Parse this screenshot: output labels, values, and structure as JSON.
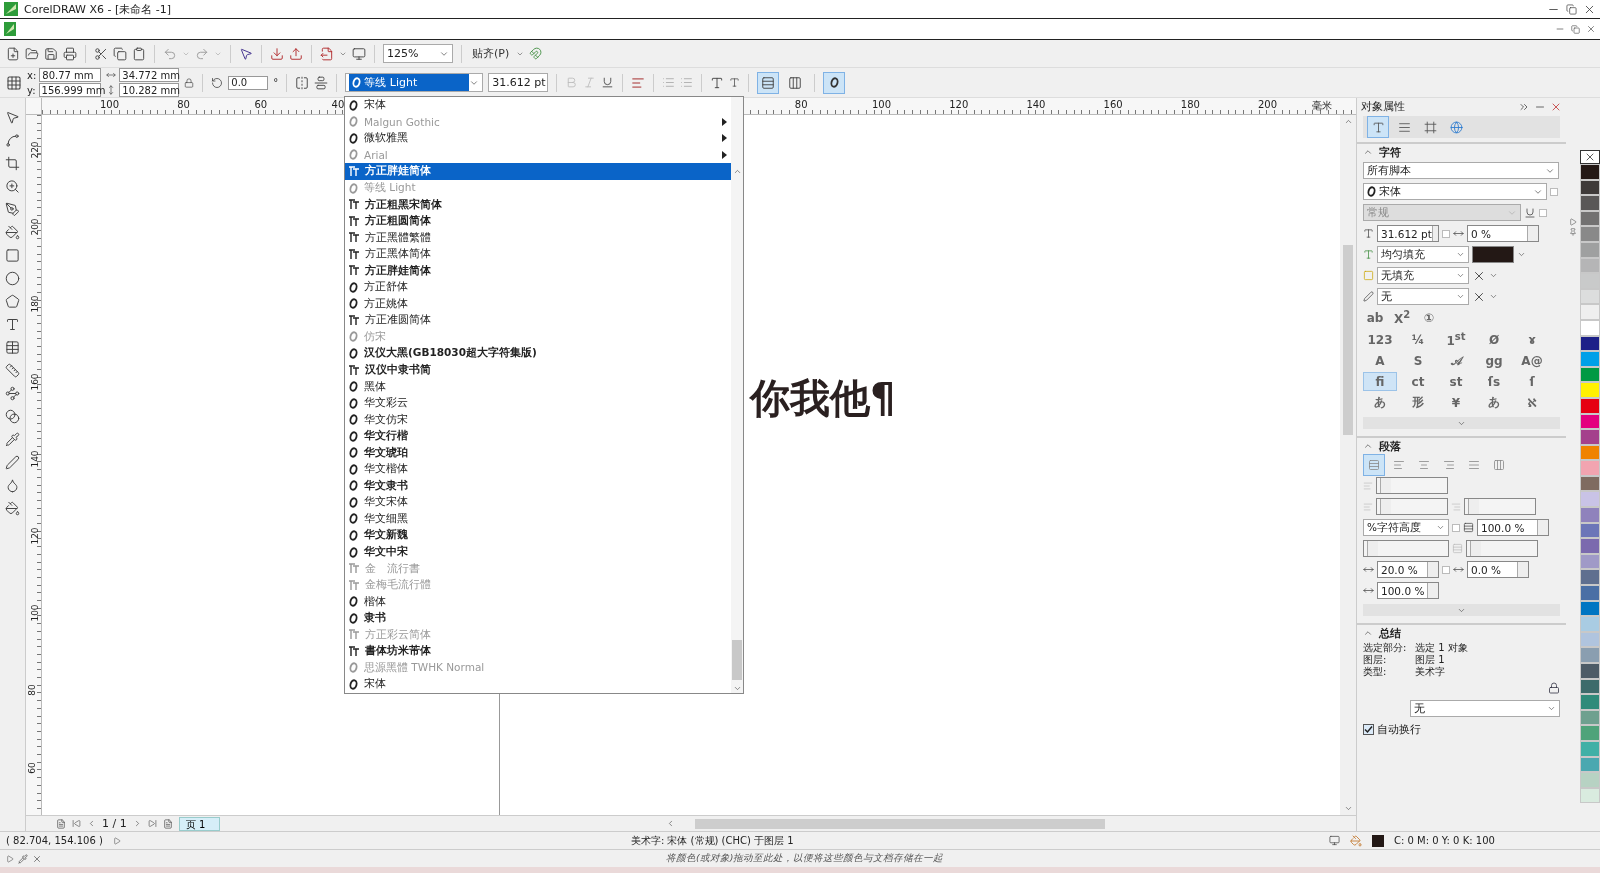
{
  "title_bar": {
    "title": "CorelDRAW X6 - [未命名 -1]"
  },
  "toolbar": {
    "zoom": "125%",
    "snap": "贴齐(P)"
  },
  "property_bar": {
    "x_label": "x:",
    "x": "80.77 mm",
    "y_label": "y:",
    "y": "156.999 mm",
    "width": "34.772 mm",
    "height": "10.282 mm",
    "rotation": "0.0",
    "degree": "°",
    "font": "等线 Light",
    "font_size": "31.612 pt",
    "orientation": [
      {
        "kind": "horizontal",
        "selected": true
      },
      {
        "kind": "vertical",
        "selected": false
      }
    ],
    "opentype_on": true
  },
  "font_list": [
    {
      "name": "宋体",
      "kind": "opentype",
      "greyed": false,
      "bold": false,
      "submenu": false,
      "selected": false
    },
    {
      "name": "Malgun Gothic",
      "kind": "opentype",
      "greyed": true,
      "bold": false,
      "submenu": true,
      "selected": false
    },
    {
      "name": "微软雅黑",
      "kind": "opentype",
      "greyed": false,
      "bold": false,
      "submenu": true,
      "selected": false
    },
    {
      "name": "Arial",
      "kind": "opentype",
      "greyed": true,
      "bold": false,
      "submenu": true,
      "selected": false
    },
    {
      "name": "方正胖娃简体",
      "kind": "truetype",
      "greyed": false,
      "bold": true,
      "submenu": false,
      "selected": true
    },
    {
      "name": "等线 Light",
      "kind": "opentype",
      "greyed": true,
      "bold": false,
      "submenu": false,
      "selected": false
    },
    {
      "name": "方正粗黑宋简体",
      "kind": "truetype",
      "greyed": false,
      "bold": true,
      "submenu": false,
      "selected": false
    },
    {
      "name": "方正粗圆简体",
      "kind": "truetype",
      "greyed": false,
      "bold": true,
      "submenu": false,
      "selected": false
    },
    {
      "name": "方正黑體繁體",
      "kind": "truetype",
      "greyed": false,
      "bold": false,
      "submenu": false,
      "selected": false
    },
    {
      "name": "方正黑体简体",
      "kind": "truetype",
      "greyed": false,
      "bold": false,
      "submenu": false,
      "selected": false
    },
    {
      "name": "方正胖娃简体",
      "kind": "truetype",
      "greyed": false,
      "bold": true,
      "submenu": false,
      "selected": false
    },
    {
      "name": "方正舒体",
      "kind": "opentype",
      "greyed": false,
      "bold": false,
      "submenu": false,
      "selected": false
    },
    {
      "name": "方正姚体",
      "kind": "opentype",
      "greyed": false,
      "bold": false,
      "submenu": false,
      "selected": false
    },
    {
      "name": "方正准圆简体",
      "kind": "truetype",
      "greyed": false,
      "bold": false,
      "submenu": false,
      "selected": false
    },
    {
      "name": "仿宋",
      "kind": "opentype",
      "greyed": true,
      "bold": false,
      "submenu": false,
      "selected": false
    },
    {
      "name": "汉仪大黑(GB18030超大字符集版)",
      "kind": "opentype",
      "greyed": false,
      "bold": true,
      "submenu": false,
      "selected": false
    },
    {
      "name": "汉仪中隶书简",
      "kind": "truetype",
      "greyed": false,
      "bold": true,
      "submenu": false,
      "selected": false
    },
    {
      "name": "黑体",
      "kind": "opentype",
      "greyed": false,
      "bold": false,
      "submenu": false,
      "selected": false
    },
    {
      "name": "华文彩云",
      "kind": "opentype",
      "greyed": false,
      "bold": false,
      "submenu": false,
      "selected": false
    },
    {
      "name": "华文仿宋",
      "kind": "opentype",
      "greyed": false,
      "bold": false,
      "submenu": false,
      "selected": false
    },
    {
      "name": "华文行楷",
      "kind": "opentype",
      "greyed": false,
      "bold": true,
      "submenu": false,
      "selected": false
    },
    {
      "name": "华文琥珀",
      "kind": "opentype",
      "greyed": false,
      "bold": true,
      "submenu": false,
      "selected": false
    },
    {
      "name": "华文楷体",
      "kind": "opentype",
      "greyed": false,
      "bold": false,
      "submenu": false,
      "selected": false
    },
    {
      "name": "华文隶书",
      "kind": "opentype",
      "greyed": false,
      "bold": true,
      "submenu": false,
      "selected": false
    },
    {
      "name": "华文宋体",
      "kind": "opentype",
      "greyed": false,
      "bold": false,
      "submenu": false,
      "selected": false
    },
    {
      "name": "华文细黑",
      "kind": "opentype",
      "greyed": false,
      "bold": false,
      "submenu": false,
      "selected": false
    },
    {
      "name": "华文新魏",
      "kind": "opentype",
      "greyed": false,
      "bold": true,
      "submenu": false,
      "selected": false
    },
    {
      "name": "华文中宋",
      "kind": "opentype",
      "greyed": false,
      "bold": true,
      "submenu": false,
      "selected": false
    },
    {
      "name": "金　流行書",
      "kind": "truetype",
      "greyed": true,
      "bold": false,
      "submenu": false,
      "selected": false
    },
    {
      "name": "金梅毛流行體",
      "kind": "truetype",
      "greyed": true,
      "bold": false,
      "submenu": false,
      "selected": false
    },
    {
      "name": "楷体",
      "kind": "opentype",
      "greyed": false,
      "bold": false,
      "submenu": false,
      "selected": false
    },
    {
      "name": "隶书",
      "kind": "opentype",
      "greyed": false,
      "bold": true,
      "submenu": false,
      "selected": false
    },
    {
      "name": "方正彩云简体",
      "kind": "truetype",
      "greyed": true,
      "bold": false,
      "submenu": false,
      "selected": false
    },
    {
      "name": "書体坊米芾体",
      "kind": "truetype",
      "greyed": false,
      "bold": true,
      "submenu": false,
      "selected": false
    },
    {
      "name": "思源黑體 TWHK Normal",
      "kind": "opentype",
      "greyed": true,
      "bold": false,
      "submenu": false,
      "selected": false
    },
    {
      "name": "宋体",
      "kind": "opentype",
      "greyed": false,
      "bold": false,
      "submenu": false,
      "selected": false
    }
  ],
  "rulers": {
    "horizontal": [
      "100",
      "80",
      "60",
      "40",
      "80",
      "100",
      "120",
      "140",
      "160",
      "180",
      "200"
    ],
    "unit": "毫米",
    "vertical": [
      "220",
      "200",
      "180",
      "160",
      "140",
      "120",
      "100",
      "80",
      "60"
    ]
  },
  "canvas": {
    "text": "你我他¶"
  },
  "page_nav": {
    "count": "1 / 1",
    "tabs": [
      {
        "label": "页 1",
        "selected": true
      }
    ]
  },
  "docker": {
    "title": "对象属性",
    "tabs": [
      {
        "kind": "character",
        "selected": true
      },
      {
        "kind": "paragraph",
        "selected": false
      },
      {
        "kind": "frame",
        "selected": false
      },
      {
        "kind": "web",
        "selected": false
      }
    ],
    "character": {
      "title": "字符",
      "script": "所有脚本",
      "font": "宋体",
      "style": "常规",
      "size": "31.612 pt",
      "kerning": "0 %",
      "fill": "均匀填充",
      "background": "无填充",
      "outline": "无",
      "features": [
        {
          "glyph": "ab",
          "selected": false
        },
        {
          "glyph": "X$^{2}$",
          "selected": false
        },
        {
          "glyph": "①",
          "selected": false
        }
      ],
      "opentype": [
        {
          "glyph": "123",
          "selected": false
        },
        {
          "glyph": "¼",
          "selected": false
        },
        {
          "glyph": "1$^{st}$",
          "selected": false
        },
        {
          "glyph": "Ø",
          "selected": false
        },
        {
          "glyph": "ɤ",
          "selected": false
        },
        {
          "glyph": "A",
          "selected": false
        },
        {
          "glyph": "S",
          "selected": false
        },
        {
          "glyph": "𝒜",
          "selected": false
        },
        {
          "glyph": "gg",
          "selected": false
        },
        {
          "glyph": "A@",
          "selected": false
        },
        {
          "glyph": "fi",
          "selected": true
        },
        {
          "glyph": "ct",
          "selected": false
        },
        {
          "glyph": "st",
          "selected": false
        },
        {
          "glyph": "ſs",
          "selected": false
        },
        {
          "glyph": "ſ",
          "selected": false
        },
        {
          "glyph": "あ",
          "selected": false
        },
        {
          "glyph": "形",
          "selected": false
        },
        {
          "glyph": "¥",
          "selected": false
        },
        {
          "glyph": "あ",
          "selected": false
        },
        {
          "glyph": "ℵ",
          "selected": false
        }
      ]
    },
    "paragraph": {
      "title": "段落",
      "alignments": [
        {
          "kind": "none",
          "selected": true
        },
        {
          "kind": "left",
          "selected": false
        },
        {
          "kind": "center",
          "selected": false
        },
        {
          "kind": "right",
          "selected": false
        },
        {
          "kind": "full",
          "selected": false
        },
        {
          "kind": "force",
          "selected": false
        }
      ],
      "spacing_unit": "%字符高度",
      "line_spacing": "100.0 %",
      "char_spacing": "20.0 %",
      "word_spacing": "0.0 %",
      "lang_spacing": "100.0 %"
    },
    "summary": {
      "title": "总结",
      "rows": [
        {
          "label": "选定部分:",
          "value": "选定 1 对象"
        },
        {
          "label": "图层:",
          "value": "图层 1"
        },
        {
          "label": "类型:",
          "value": "美术字"
        }
      ],
      "dropdown": "无",
      "wrap": {
        "label": "自动换行",
        "checked": true
      }
    }
  },
  "palette": [
    {
      "color": "#231815"
    },
    {
      "color": "#3e3a39"
    },
    {
      "color": "#595757"
    },
    {
      "color": "#727171"
    },
    {
      "color": "#898989"
    },
    {
      "color": "#9fa0a0"
    },
    {
      "color": "#b5b5b6"
    },
    {
      "color": "#c9caca"
    },
    {
      "color": "#dcdddd"
    },
    {
      "color": "#efefef"
    },
    {
      "color": "#ffffff"
    },
    {
      "color": "#1d2088"
    },
    {
      "color": "#00a0e9"
    },
    {
      "color": "#009944"
    },
    {
      "color": "#fff100"
    },
    {
      "color": "#e60012"
    },
    {
      "color": "#e4007f"
    },
    {
      "color": "#a4418c"
    },
    {
      "color": "#f08300"
    },
    {
      "color": "#f2a4b0"
    },
    {
      "color": "#7f6b60"
    },
    {
      "color": "#c9c3e6"
    },
    {
      "color": "#8f82bc"
    },
    {
      "color": "#6c76b8"
    },
    {
      "color": "#7b6aae"
    },
    {
      "color": "#a09ac7"
    },
    {
      "color": "#5f6f8f"
    },
    {
      "color": "#4a6fa5"
    },
    {
      "color": "#0075c2"
    },
    {
      "color": "#a9cce3"
    },
    {
      "color": "#b0c4de"
    },
    {
      "color": "#8a9eb0"
    },
    {
      "color": "#4d5b66"
    },
    {
      "color": "#3d6b6b"
    },
    {
      "color": "#2e8b7a"
    },
    {
      "color": "#6fa08f"
    },
    {
      "color": "#4fa37a"
    },
    {
      "color": "#40b0a6"
    },
    {
      "color": "#4aa8b0"
    },
    {
      "color": "#b7d2c3"
    },
    {
      "color": "#d9ebdf"
    }
  ],
  "status_bar": {
    "coords": "( 82.704, 154.106 )",
    "info": "美术字: 宋体 (常规) (CHC) 于图层 1",
    "cmyk": "C: 0 M: 0 Y: 0 K: 100"
  },
  "document_palette": {
    "hint": "将颜色(或对象)拖动至此处，以便将这些颜色与文档存储在一起"
  }
}
